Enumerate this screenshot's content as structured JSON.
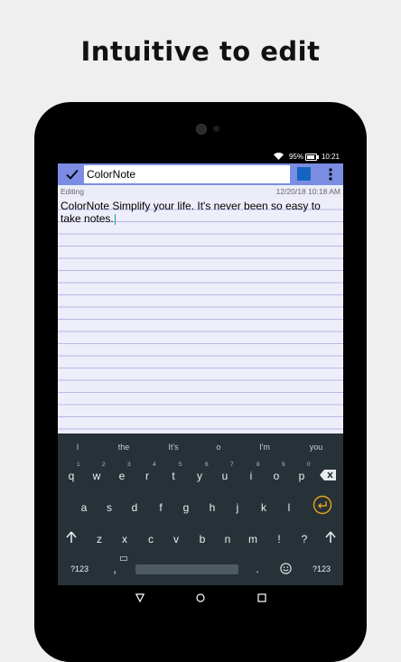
{
  "headline": "Intuitive to edit",
  "status": {
    "battery": "95%",
    "time": "10:21"
  },
  "toolbar": {
    "title": "ColorNote",
    "note_color": "#1565c0"
  },
  "meta": {
    "mode": "Editing",
    "timestamp": "12/20/18 10:18 AM"
  },
  "note": {
    "text": "ColorNote Simplify your life. It's never been so easy to take notes."
  },
  "keyboard": {
    "suggestions": [
      "I",
      "the",
      "It's",
      "o",
      "I'm",
      "you"
    ],
    "row1": [
      "q",
      "w",
      "e",
      "r",
      "t",
      "y",
      "u",
      "i",
      "o",
      "p"
    ],
    "row1_hints": [
      "1",
      "2",
      "3",
      "4",
      "5",
      "6",
      "7",
      "8",
      "9",
      "0"
    ],
    "row2": [
      "a",
      "s",
      "d",
      "f",
      "g",
      "h",
      "j",
      "k",
      "l"
    ],
    "row3": [
      "z",
      "x",
      "c",
      "v",
      "b",
      "n",
      "m",
      "!",
      "?"
    ],
    "symbols_label": "?123",
    "comma": ",",
    "period": ".",
    "symbols_label_right": "?123"
  },
  "colors": {
    "toolbar": "#7b8de3",
    "paper": "#eeeefb",
    "rule": "#b7b7e6",
    "keyboard": "#263238",
    "enter_accent": "#e8a317",
    "swatch": "#1565c0"
  },
  "icons": [
    "check-icon",
    "menu-dots-icon",
    "wifi-icon",
    "battery-icon",
    "backspace-icon",
    "enter-icon",
    "shift-icon",
    "emoji-icon",
    "keyboard-icon",
    "back-icon",
    "home-icon",
    "recents-icon"
  ]
}
